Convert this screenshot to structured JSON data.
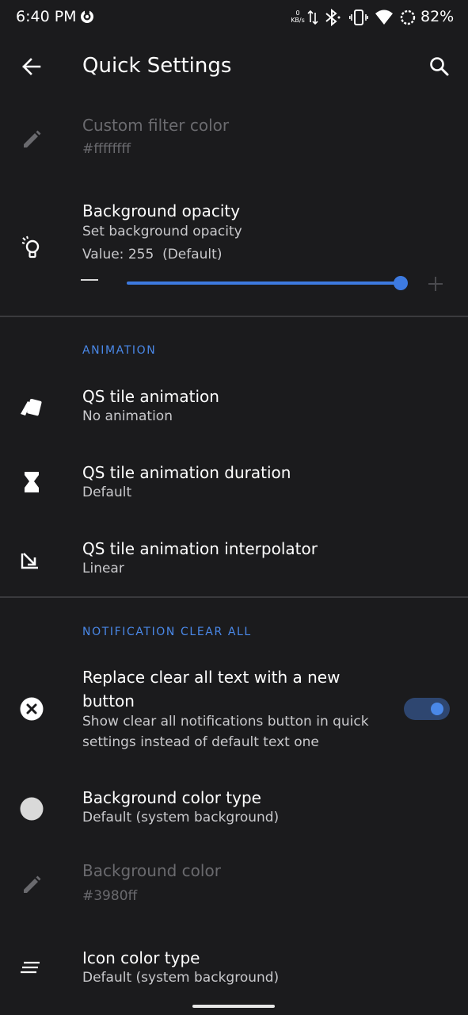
{
  "status_bar": {
    "time": "6:40 PM",
    "net_speed_value": "0",
    "net_speed_unit": "KB/s",
    "battery": "82%",
    "icons": [
      "cast-icon",
      "data-arrows-icon",
      "bluetooth-icon",
      "vibrate-icon",
      "wifi-icon",
      "battery-saver-icon"
    ]
  },
  "app_bar": {
    "title": "Quick Settings",
    "back_icon": "arrow-back-icon",
    "search_icon": "search-icon"
  },
  "settings": {
    "custom_filter": {
      "title": "Custom filter color",
      "subtitle": "#ffffffff",
      "icon": "pencil-icon",
      "enabled": false
    },
    "bg_opacity": {
      "title": "Background opacity",
      "subtitle": "Set background opacity",
      "value_text": "Value: 255  (Default)",
      "icon": "lightbulb-icon",
      "slider_value": 255,
      "slider_max": 255
    }
  },
  "sections": {
    "animation": {
      "header": "ANIMATION",
      "items": [
        {
          "title": "QS tile animation",
          "subtitle": "No animation",
          "icon": "tile-animation-icon"
        },
        {
          "title": "QS tile animation duration",
          "subtitle": "Default",
          "icon": "hourglass-icon"
        },
        {
          "title": "QS tile animation interpolator",
          "subtitle": "Linear",
          "icon": "interpolator-arrow-icon"
        }
      ]
    },
    "clear_all": {
      "header": "NOTIFICATION CLEAR ALL",
      "replace": {
        "title_line1": "Replace clear all text with a new",
        "title_line2": "button",
        "subtitle_line1": "Show clear all notifications button in quick",
        "subtitle_line2": "settings instead of default text one",
        "icon": "close-circle-icon",
        "toggle_on": true
      },
      "bg_color_type": {
        "title": "Background color type",
        "subtitle": "Default (system background)",
        "icon": "circle-icon"
      },
      "bg_color": {
        "title": "Background color",
        "subtitle": "#3980ff",
        "icon": "pencil-icon",
        "enabled": false
      },
      "icon_color_type": {
        "title": "Icon color type",
        "subtitle": "Default (system background)",
        "icon": "lines-icon"
      }
    }
  },
  "colors": {
    "background": "#1b1b1d",
    "accent": "#3d7ae0",
    "section_header": "#4a88e8",
    "disabled_text": "#6a6a6e"
  }
}
